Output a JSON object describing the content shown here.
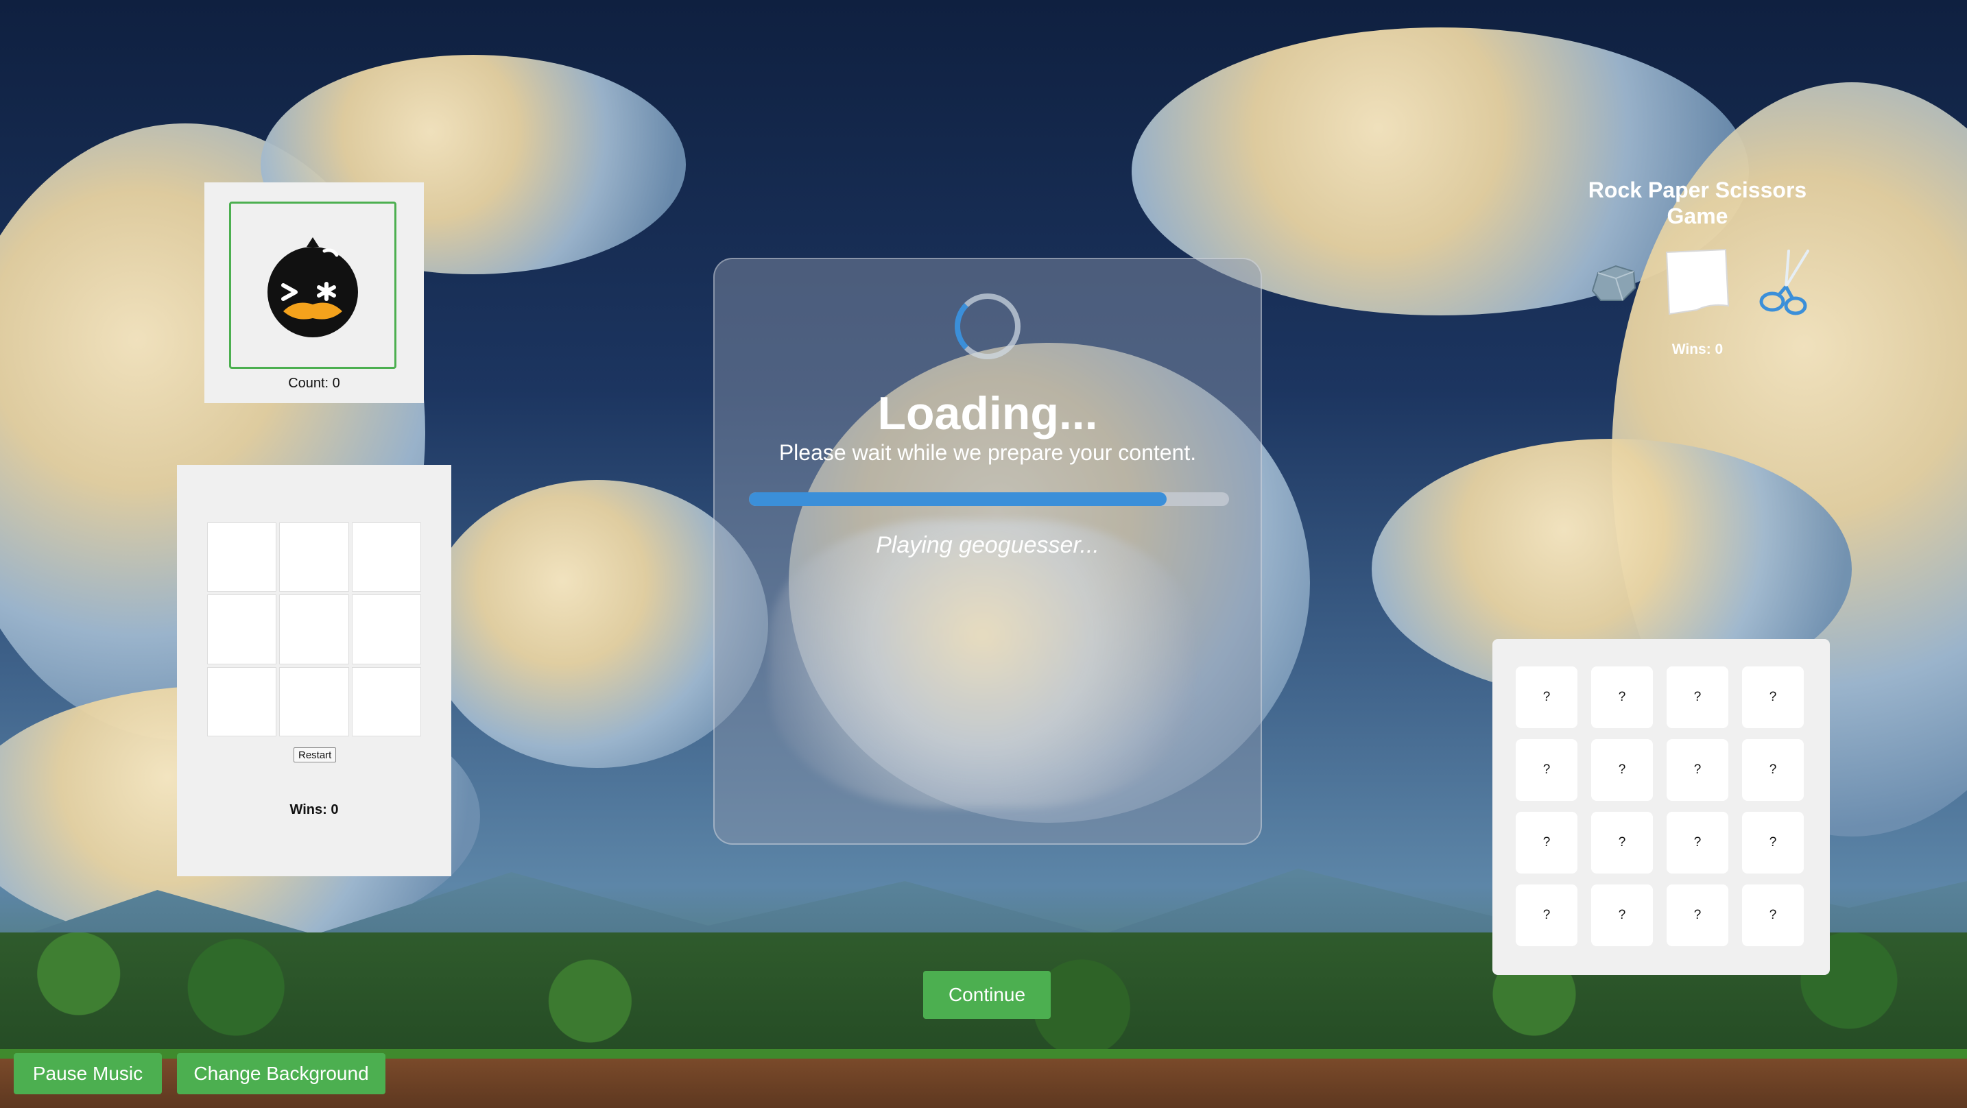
{
  "pet": {
    "count_label": "Count: 0"
  },
  "tictactoe": {
    "cells": [
      "",
      "",
      "",
      "",
      "",
      "",
      "",
      "",
      ""
    ],
    "restart_label": "Restart",
    "wins_label": "Wins: 0"
  },
  "loading": {
    "title": "Loading...",
    "subtitle": "Please wait while we prepare your content.",
    "progress_percent": 87,
    "status": "Playing geoguesser..."
  },
  "rps": {
    "title": "Rock Paper Scissors Game",
    "choices": [
      "rock-icon",
      "paper-icon",
      "scissors-icon"
    ],
    "wins_label": "Wins: 0"
  },
  "memory": {
    "cards": [
      "?",
      "?",
      "?",
      "?",
      "?",
      "?",
      "?",
      "?",
      "?",
      "?",
      "?",
      "?",
      "?",
      "?",
      "?",
      "?"
    ]
  },
  "buttons": {
    "continue_label": "Continue",
    "pause_label": "Pause Music",
    "change_background_label": "Change Background"
  },
  "colors": {
    "accent_green": "#4caf50",
    "progress_blue": "#3b8fd9"
  }
}
